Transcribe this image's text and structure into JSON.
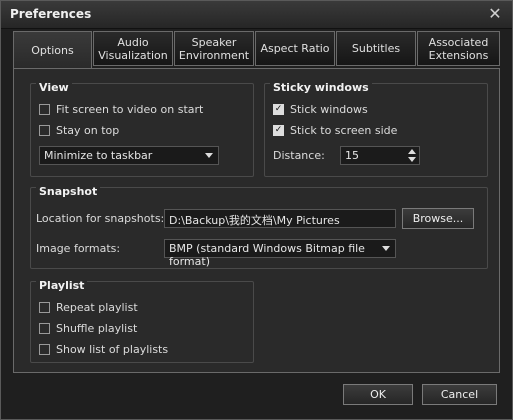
{
  "window": {
    "title": "Preferences",
    "close_label": "✕"
  },
  "tabs": [
    {
      "label": "Options"
    },
    {
      "label": "Audio\nVisualization"
    },
    {
      "label": "Speaker\nEnvironment"
    },
    {
      "label": "Aspect Ratio"
    },
    {
      "label": "Subtitles"
    },
    {
      "label": "Associated\nExtensions"
    }
  ],
  "view": {
    "title": "View",
    "fit_screen": {
      "label": "Fit screen to video on start",
      "checked": false
    },
    "stay_on_top": {
      "label": "Stay on top",
      "checked": false
    },
    "minimize_select": {
      "value": "Minimize to taskbar"
    }
  },
  "sticky": {
    "title": "Sticky windows",
    "stick_windows": {
      "label": "Stick windows",
      "checked": true
    },
    "stick_screen_side": {
      "label": "Stick to screen side",
      "checked": true
    },
    "distance_label": "Distance:",
    "distance_value": "15"
  },
  "snapshot": {
    "title": "Snapshot",
    "location_label": "Location for snapshots:",
    "location_value": "D:\\Backup\\我的文档\\My Pictures",
    "browse_label": "Browse...",
    "format_label": "Image formats:",
    "format_value": "BMP (standard Windows Bitmap file format)"
  },
  "playlist": {
    "title": "Playlist",
    "repeat": {
      "label": "Repeat playlist",
      "checked": false
    },
    "shuffle": {
      "label": "Shuffle playlist",
      "checked": false
    },
    "show_list": {
      "label": "Show list of playlists",
      "checked": false
    }
  },
  "footer": {
    "ok_label": "OK",
    "cancel_label": "Cancel"
  }
}
